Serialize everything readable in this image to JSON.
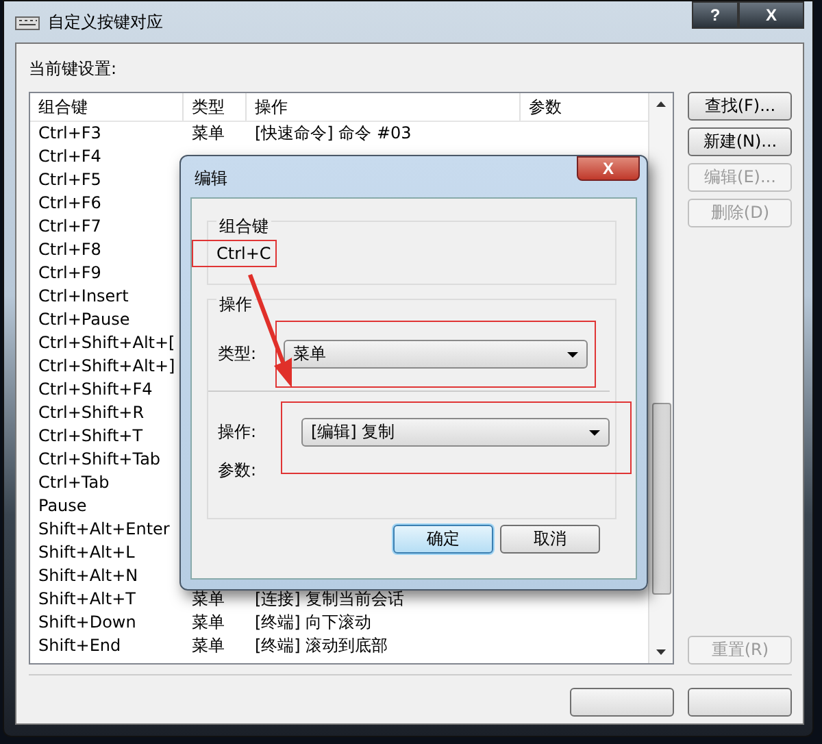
{
  "window": {
    "title": "自定义按键对应",
    "title_buttons": [
      "?",
      "X"
    ]
  },
  "current_label": "当前键设置:",
  "table": {
    "columns": [
      "组合键",
      "类型",
      "操作",
      "参数"
    ],
    "rows": [
      {
        "key": "Ctrl+F3",
        "type": "菜单",
        "action": "[快速命令] 命令 #03"
      },
      {
        "key": "Ctrl+F4"
      },
      {
        "key": "Ctrl+F5"
      },
      {
        "key": "Ctrl+F6"
      },
      {
        "key": "Ctrl+F7"
      },
      {
        "key": "Ctrl+F8"
      },
      {
        "key": "Ctrl+F9"
      },
      {
        "key": "Ctrl+Insert"
      },
      {
        "key": "Ctrl+Pause"
      },
      {
        "key": "Ctrl+Shift+Alt+["
      },
      {
        "key": "Ctrl+Shift+Alt+]"
      },
      {
        "key": "Ctrl+Shift+F4"
      },
      {
        "key": "Ctrl+Shift+R"
      },
      {
        "key": "Ctrl+Shift+T"
      },
      {
        "key": "Ctrl+Shift+Tab"
      },
      {
        "key": "Ctrl+Tab"
      },
      {
        "key": "Pause"
      },
      {
        "key": "Shift+Alt+Enter"
      },
      {
        "key": "Shift+Alt+L"
      },
      {
        "key": "Shift+Alt+N"
      },
      {
        "key": "Shift+Alt+T",
        "type": "菜单",
        "action": "[连接] 复制当前会话"
      },
      {
        "key": "Shift+Down",
        "type": "菜单",
        "action": "[终端] 向下滚动"
      },
      {
        "key": "Shift+End",
        "type": "菜单",
        "action": "[终端] 滚动到底部"
      }
    ]
  },
  "side_buttons": [
    {
      "label": "查找(F)...",
      "disabled": false
    },
    {
      "label": "新建(N)...",
      "disabled": false
    },
    {
      "label": "编辑(E)...",
      "disabled": true
    },
    {
      "label": "删除(D)",
      "disabled": true
    }
  ],
  "reset_button": {
    "label": "重置(R)",
    "disabled": true
  },
  "dialog": {
    "title": "编辑",
    "close": "X",
    "key_group": "组合键",
    "key": "Ctrl+C",
    "action_group": "操作",
    "type_label": "类型:",
    "type_value": "菜单",
    "action_label": "操作:",
    "action_value": "[编辑] 复制",
    "param_label": "参数:",
    "ok": "确定",
    "cancel": "取消"
  }
}
